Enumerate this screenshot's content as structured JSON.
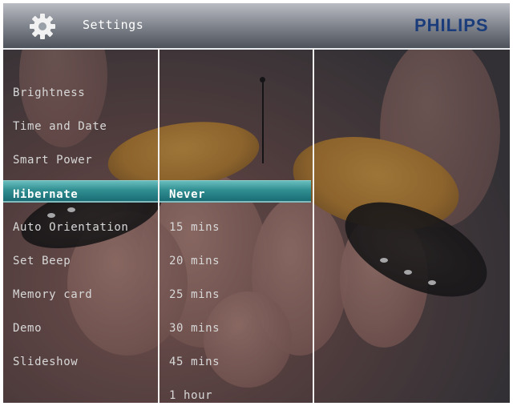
{
  "header": {
    "title": "Settings",
    "brand": "PHILIPS",
    "icon": "gear-icon"
  },
  "settings_menu": {
    "items": [
      {
        "label": "Brightness"
      },
      {
        "label": "Time and Date"
      },
      {
        "label": "Smart Power"
      },
      {
        "label": "Hibernate",
        "selected": true
      },
      {
        "label": "Auto Orientation"
      },
      {
        "label": "Set Beep"
      },
      {
        "label": "Memory card"
      },
      {
        "label": "Demo"
      },
      {
        "label": "Slideshow"
      }
    ]
  },
  "hibernate_options": {
    "items": [
      {
        "label": "Never",
        "selected": true
      },
      {
        "label": "15 mins"
      },
      {
        "label": "20 mins"
      },
      {
        "label": "25 mins"
      },
      {
        "label": "30 mins"
      },
      {
        "label": "45 mins"
      },
      {
        "label": "1 hour"
      }
    ]
  },
  "colors": {
    "selection": "#2f8e91",
    "brand": "#1b3c7a",
    "divider": "#f3f1ef"
  }
}
